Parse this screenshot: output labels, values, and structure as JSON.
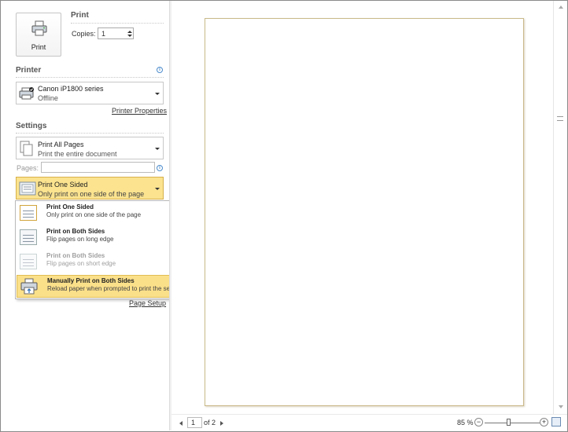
{
  "print": {
    "heading": "Print",
    "button_label": "Print",
    "copies_label": "Copies:",
    "copies_value": "1"
  },
  "printer": {
    "heading": "Printer",
    "name": "Canon iP1800 series",
    "status": "Offline",
    "properties_link": "Printer Properties"
  },
  "settings": {
    "heading": "Settings",
    "range": {
      "title": "Print All Pages",
      "subtitle": "Print the entire document"
    },
    "pages_label": "Pages:",
    "pages_value": "",
    "sides": {
      "title": "Print One Sided",
      "subtitle": "Only print on one side of the page"
    },
    "page_setup_link": "Page Setup"
  },
  "sides_menu": {
    "items": [
      {
        "title": "Print One Sided",
        "subtitle": "Only print on one side of the page",
        "state": "selected"
      },
      {
        "title": "Print on Both Sides",
        "subtitle": "Flip pages on long edge",
        "state": "normal"
      },
      {
        "title": "Print on Both Sides",
        "subtitle": "Flip pages on short edge",
        "state": "disabled"
      },
      {
        "title": "Manually Print on Both Sides",
        "subtitle": "Reload paper when prompted to print the second side",
        "state": "hover"
      }
    ]
  },
  "preview_nav": {
    "current_page": "1",
    "of_text": "of 2",
    "zoom": "85 %"
  },
  "colors": {
    "highlight": "#fbe08a",
    "info_blue": "#4c8ccc"
  }
}
